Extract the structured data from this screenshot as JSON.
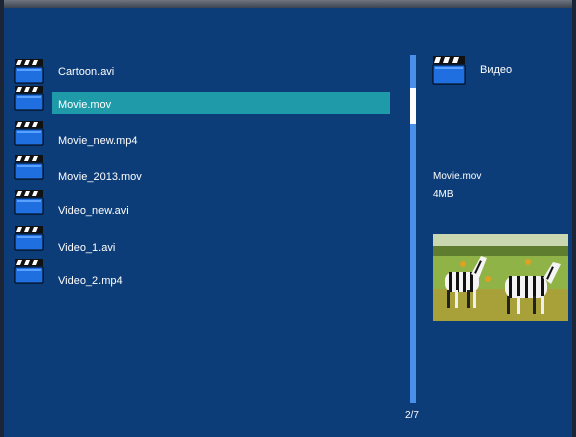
{
  "window": {
    "title": ""
  },
  "file_list": {
    "items": [
      {
        "name": "Cartoon.avi",
        "selected": false
      },
      {
        "name": "Movie.mov",
        "selected": true
      },
      {
        "name": "Movie_new.mp4",
        "selected": false
      },
      {
        "name": "Movie_2013.mov",
        "selected": false
      },
      {
        "name": "Video_new.avi",
        "selected": false
      },
      {
        "name": "Video_1.avi",
        "selected": false
      },
      {
        "name": "Video_2.mp4",
        "selected": false
      }
    ]
  },
  "pagination": {
    "label": "2/7"
  },
  "info_panel": {
    "category_label": "Видео",
    "file_name": "Movie.mov",
    "file_size": "4MB"
  },
  "colors": {
    "background": "#0d3d78",
    "selection": "#1e9aa8",
    "scrollbar": "#4a90e8",
    "text": "#ffffff"
  },
  "icons": {
    "file_icon": "clapperboard-icon",
    "category_icon": "clapperboard-icon"
  }
}
